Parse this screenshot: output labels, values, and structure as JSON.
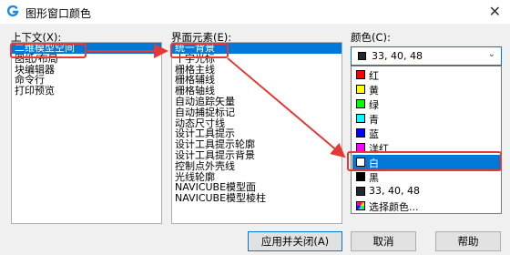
{
  "window": {
    "title": "图形窗口颜色",
    "close": "✕"
  },
  "context": {
    "label": "上下文(X):",
    "items": [
      "二维模型空间",
      "图纸/布局",
      "块编辑器",
      "命令行",
      "打印预览"
    ],
    "selected_index": 0
  },
  "elements": {
    "label": "界面元素(E):",
    "items": [
      "统一背景",
      "十字光标",
      "栅格主线",
      "栅格辅线",
      "栅格轴线",
      "自动追踪矢量",
      "自动捕捉标记",
      "动态尺寸线",
      "设计工具提示",
      "设计工具提示轮廓",
      "设计工具提示背景",
      "控制点外壳线",
      "光线轮廓",
      "NAVICUBE模型面",
      "NAVICUBE模型棱柱"
    ],
    "selected_index": 0
  },
  "color": {
    "label": "颜色(C):",
    "current_value": "33, 40, 48",
    "current_swatch": "#212830",
    "options": [
      {
        "name": "红",
        "swatch": "#ff0000"
      },
      {
        "name": "黄",
        "swatch": "#ffff00"
      },
      {
        "name": "绿",
        "swatch": "#00ff00"
      },
      {
        "name": "青",
        "swatch": "#00ffff"
      },
      {
        "name": "蓝",
        "swatch": "#0000ff"
      },
      {
        "name": "洋红",
        "swatch": "#ff00ff"
      },
      {
        "name": "白",
        "swatch": "#ffffff"
      },
      {
        "name": "黑",
        "swatch": "#000000"
      },
      {
        "name": "33, 40, 48",
        "swatch": "#212830"
      },
      {
        "name": "选择颜色...",
        "swatch": "rainbow"
      }
    ],
    "selected_index": 6
  },
  "buttons": {
    "apply_close": "应用并关闭(A)",
    "cancel": "取消",
    "help": "帮助"
  },
  "colors": {
    "accent": "#0078d7",
    "highlight": "#e53935"
  }
}
